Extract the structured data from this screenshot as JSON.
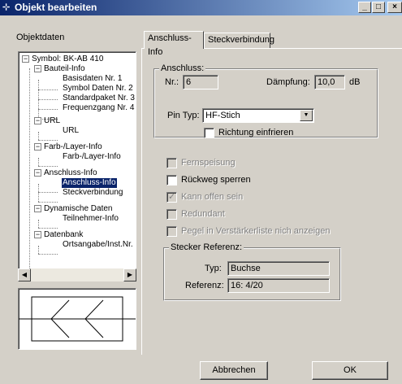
{
  "window": {
    "title": "Objekt bearbeiten",
    "app_icon": "⊹",
    "btn_minimize": "_",
    "btn_maximize": "□",
    "btn_close": "×"
  },
  "left": {
    "section_label": "Objektdaten",
    "tree": [
      {
        "label": "Symbol: BK-AB 410",
        "toggle": "−"
      },
      {
        "label": "Bauteil-Info",
        "toggle": "−"
      },
      {
        "label": "Basisdaten Nr. 1"
      },
      {
        "label": "Symbol Daten Nr. 2"
      },
      {
        "label": "Standardpaket Nr. 3"
      },
      {
        "label": "Frequenzgang Nr. 4"
      },
      {
        "label": "URL",
        "toggle": "−"
      },
      {
        "label": "URL"
      },
      {
        "label": "Farb-/Layer-Info",
        "toggle": "−"
      },
      {
        "label": "Farb-/Layer-Info"
      },
      {
        "label": "Anschluss-Info",
        "toggle": "−"
      },
      {
        "label": "Anschluss-Info",
        "selected": true
      },
      {
        "label": "Steckverbindung"
      },
      {
        "label": "Dynamische Daten",
        "toggle": "−"
      },
      {
        "label": "Teilnehmer-Info"
      },
      {
        "label": "Datenbank",
        "toggle": "−"
      },
      {
        "label": "Ortsangabe/Inst.Nr."
      }
    ],
    "scroll_left": "◀",
    "scroll_right": "▶"
  },
  "tabs": [
    {
      "label": "Anschluss-Info",
      "active": true
    },
    {
      "label": "Steckverbindung",
      "active": false
    }
  ],
  "anschluss": {
    "group_title": "Anschluss:",
    "nr_label": "Nr.:",
    "nr_value": "6",
    "daempfung_label": "Dämpfung:",
    "daempfung_value": "10,0",
    "daempfung_unit": "dB",
    "pin_typ_label": "Pin Typ:",
    "pin_typ_value": "HF-Stich",
    "combo_arrow": "▼",
    "richtung_label": "Richtung einfrieren"
  },
  "options": {
    "fernspeisung": "Fernspeisung",
    "rueckweg": "Rückweg sperren",
    "kann_offen": "Kann offen sein",
    "kann_offen_checked": true,
    "redundant": "Redundant",
    "pegel": "Pegel in Verstärkerliste nich anzeigen",
    "check_mark": "✓"
  },
  "stecker": {
    "group_title": "Stecker Referenz:",
    "typ_label": "Typ:",
    "typ_value": "Buchse",
    "referenz_label": "Referenz:",
    "referenz_value": "16: 4/20"
  },
  "buttons": {
    "cancel": "Abbrechen",
    "ok": "OK"
  }
}
